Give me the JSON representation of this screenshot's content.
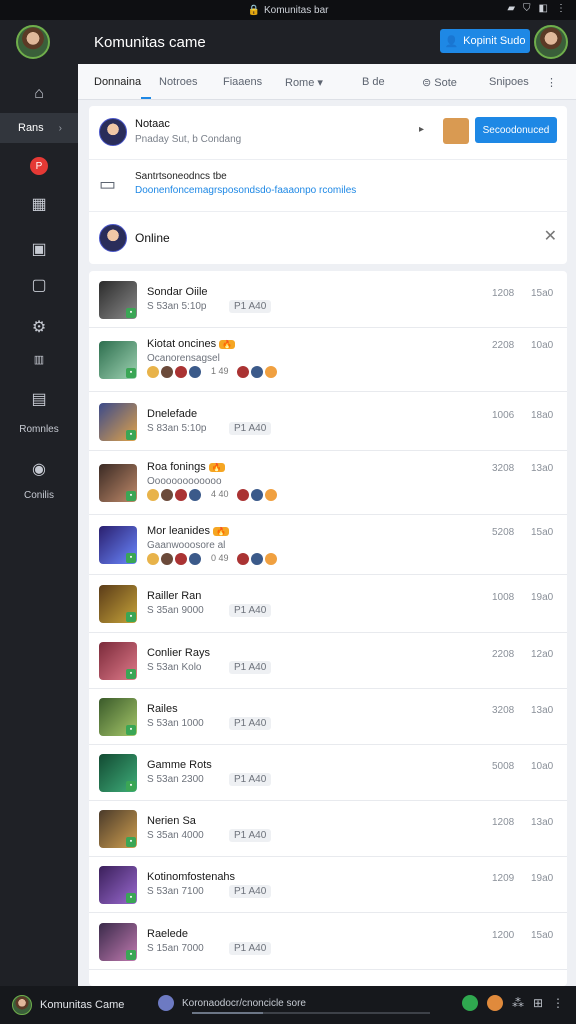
{
  "system_bar": {
    "title": "Komunitas bar"
  },
  "header": {
    "title": "Komunitas came",
    "join_label": "Kopinit Sudo"
  },
  "sidebar": {
    "items": [
      {
        "icon": "home-icon"
      },
      {
        "label": "Rans"
      },
      {
        "icon": "red-badge-icon",
        "badge": "P"
      },
      {
        "icon": "chart-icon"
      },
      {
        "icon": "image-icon"
      },
      {
        "icon": "card-icon"
      },
      {
        "icon": "gear-icon"
      },
      {
        "icon": "list-icon"
      },
      {
        "icon": "message-icon",
        "label": "Romnles"
      },
      {
        "icon": "user-icon",
        "label": "Conilis"
      }
    ]
  },
  "tabs": [
    "Donnaina",
    "Notroes",
    "Fiaaens",
    "Rome",
    "B de",
    "Sote",
    "Snipoes"
  ],
  "notice": {
    "title": "Notaac",
    "subtitle": "Pnaday Sut, b Condang",
    "button": "Secoodonuced"
  },
  "banner": {
    "line1": "Santrtsoneodncs tbe",
    "line2": "Doonenfoncemagrsposondsdo-faaaonpo rcomiles"
  },
  "online": {
    "label": "Online"
  },
  "games": [
    {
      "name": "Sondar Oiile",
      "meta": "S 53an 5:10p",
      "badge": "P1 A40",
      "col1": "1208",
      "col2": "15a0",
      "fire": false,
      "chips": false
    },
    {
      "name": "Kiotat oncines",
      "meta": "Ocanorensagsel",
      "badge": "1 49",
      "col1": "2208",
      "col2": "10a0",
      "fire": true,
      "chips": true
    },
    {
      "name": "Dnelefade",
      "meta": "S 83an 5:10p",
      "badge": "P1 A40",
      "col1": "1006",
      "col2": "18a0",
      "fire": false,
      "chips": false
    },
    {
      "name": "Roa fonings",
      "meta": "Ooooooooooooo",
      "badge": "4 40",
      "col1": "3208",
      "col2": "13a0",
      "fire": true,
      "chips": true
    },
    {
      "name": "Mor leanides",
      "meta": "Gaanwooosore al",
      "badge": "0 49",
      "col1": "5208",
      "col2": "15a0",
      "fire": true,
      "chips": true
    },
    {
      "name": "Railler Ran",
      "meta": "S 35an 9000",
      "badge": "P1 A40",
      "col1": "1008",
      "col2": "19a0",
      "fire": false,
      "chips": false
    },
    {
      "name": "Conlier Rays",
      "meta": "S 53an Kolo",
      "badge": "P1 A40",
      "col1": "2208",
      "col2": "12a0",
      "fire": false,
      "chips": false
    },
    {
      "name": "Railes",
      "meta": "S 53an 1000",
      "badge": "P1 A40",
      "col1": "3208",
      "col2": "13a0",
      "fire": false,
      "chips": false
    },
    {
      "name": "Gamme Rots",
      "meta": "S 53an 2300",
      "badge": "P1 A40",
      "col1": "5008",
      "col2": "10a0",
      "fire": false,
      "chips": false
    },
    {
      "name": "Nerien Sa",
      "meta": "S 35an 4000",
      "badge": "P1 A40",
      "col1": "1208",
      "col2": "13a0",
      "fire": false,
      "chips": false
    },
    {
      "name": "Kotinomfostenahs",
      "meta": "S 53an 7100",
      "badge": "P1 A40",
      "col1": "1209",
      "col2": "19a0",
      "fire": false,
      "chips": false
    },
    {
      "name": "Raelede",
      "meta": "S 15an 7000",
      "badge": "P1 A40",
      "col1": "1200",
      "col2": "15a0",
      "fire": false,
      "chips": false
    }
  ],
  "bottom": {
    "name": "Komunitas Came",
    "track": "Koronaodocr/cnoncicle sore",
    "progress": 0.3
  },
  "colors": {
    "accent": "#1e88e5",
    "sidebar": "#1f2126",
    "main_bg": "#eef0f4"
  }
}
